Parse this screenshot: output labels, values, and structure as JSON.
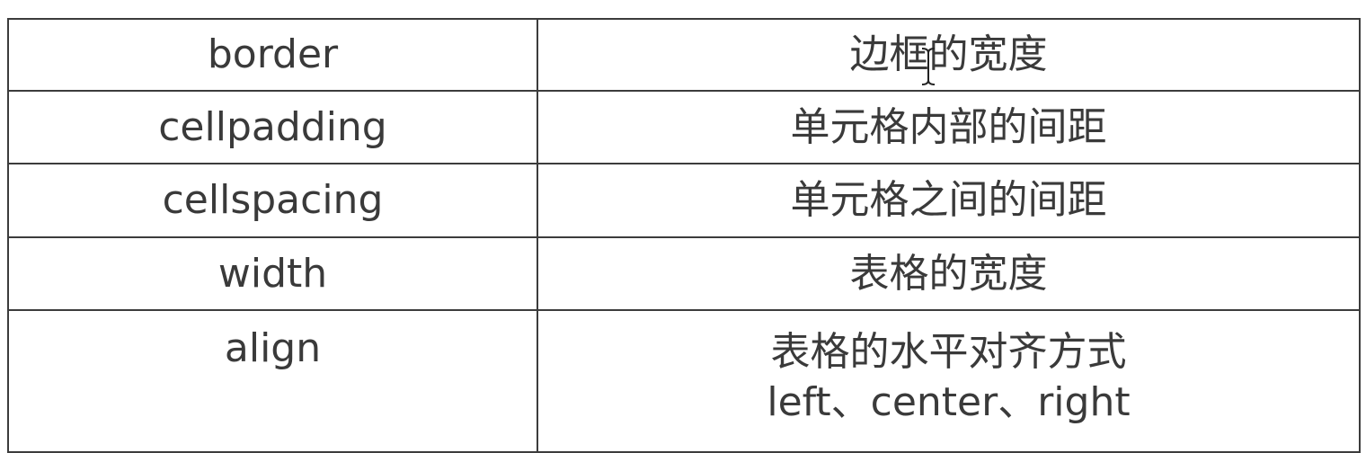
{
  "table": {
    "rows": [
      {
        "name": "border",
        "description": "边框的宽度"
      },
      {
        "name": "cellpadding",
        "description": "单元格内部的间距"
      },
      {
        "name": "cellspacing",
        "description": "单元格之间的间距"
      },
      {
        "name": "width",
        "description": "表格的宽度"
      },
      {
        "name": "align",
        "description": "表格的水平对齐方式",
        "description_line2": "left、center、right"
      }
    ]
  },
  "cursor": {
    "icon": "text-cursor-icon"
  }
}
